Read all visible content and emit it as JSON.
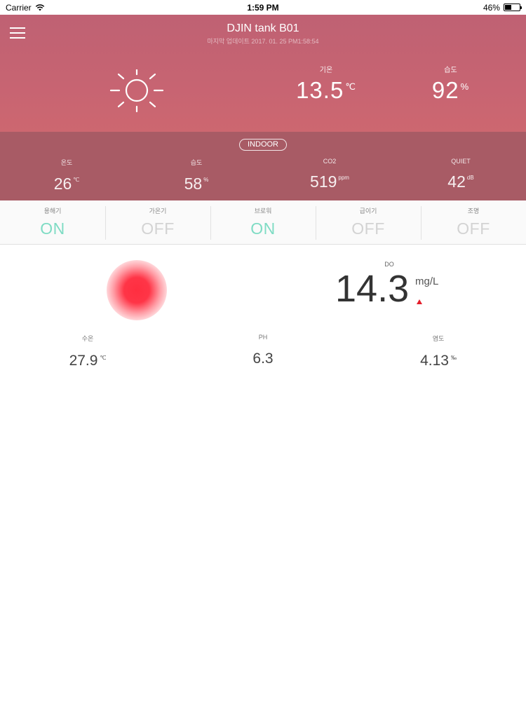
{
  "status_bar": {
    "carrier": "Carrier",
    "time": "1:59 PM",
    "battery": "46%",
    "battery_level": 0.46
  },
  "header": {
    "title": "DJIN tank B01",
    "last_update": "마지막 업데이트 2017. 01. 25 PM1:58:54",
    "weather_icon": "sun-icon",
    "outdoor": {
      "temp_label": "기온",
      "temp_value": "13.5",
      "temp_unit": "℃",
      "humidity_label": "습도",
      "humidity_value": "92",
      "humidity_unit": "%"
    }
  },
  "indoor": {
    "badge": "INDOOR",
    "items": [
      {
        "label": "온도",
        "value": "26",
        "unit": "℃"
      },
      {
        "label": "습도",
        "value": "58",
        "unit": "%"
      },
      {
        "label": "CO2",
        "value": "519",
        "unit": "ppm"
      },
      {
        "label": "QUIET",
        "value": "42",
        "unit": "dB"
      }
    ]
  },
  "switches": [
    {
      "label": "용해기",
      "state": "ON"
    },
    {
      "label": "가온기",
      "state": "OFF"
    },
    {
      "label": "브로워",
      "state": "ON"
    },
    {
      "label": "급이기",
      "state": "OFF"
    },
    {
      "label": "조명",
      "state": "OFF"
    }
  ],
  "tank": {
    "status_color": "#ff2e40",
    "do_label": "DO",
    "do_value": "14.3",
    "do_unit": "mg/L",
    "do_trend": "up",
    "water_temp_label": "수온",
    "water_temp_value": "27.9",
    "water_temp_unit": "℃",
    "ph_label": "PH",
    "ph_value": "6.3",
    "salinity_label": "염도",
    "salinity_value": "4.13",
    "salinity_unit": "‰"
  },
  "colors": {
    "header_bg": "#c76472",
    "indoor_bg": "#a85b65",
    "switch_on": "#7fdcc4",
    "switch_off": "#d3d3d3",
    "trend_up": "#e41e2b"
  }
}
